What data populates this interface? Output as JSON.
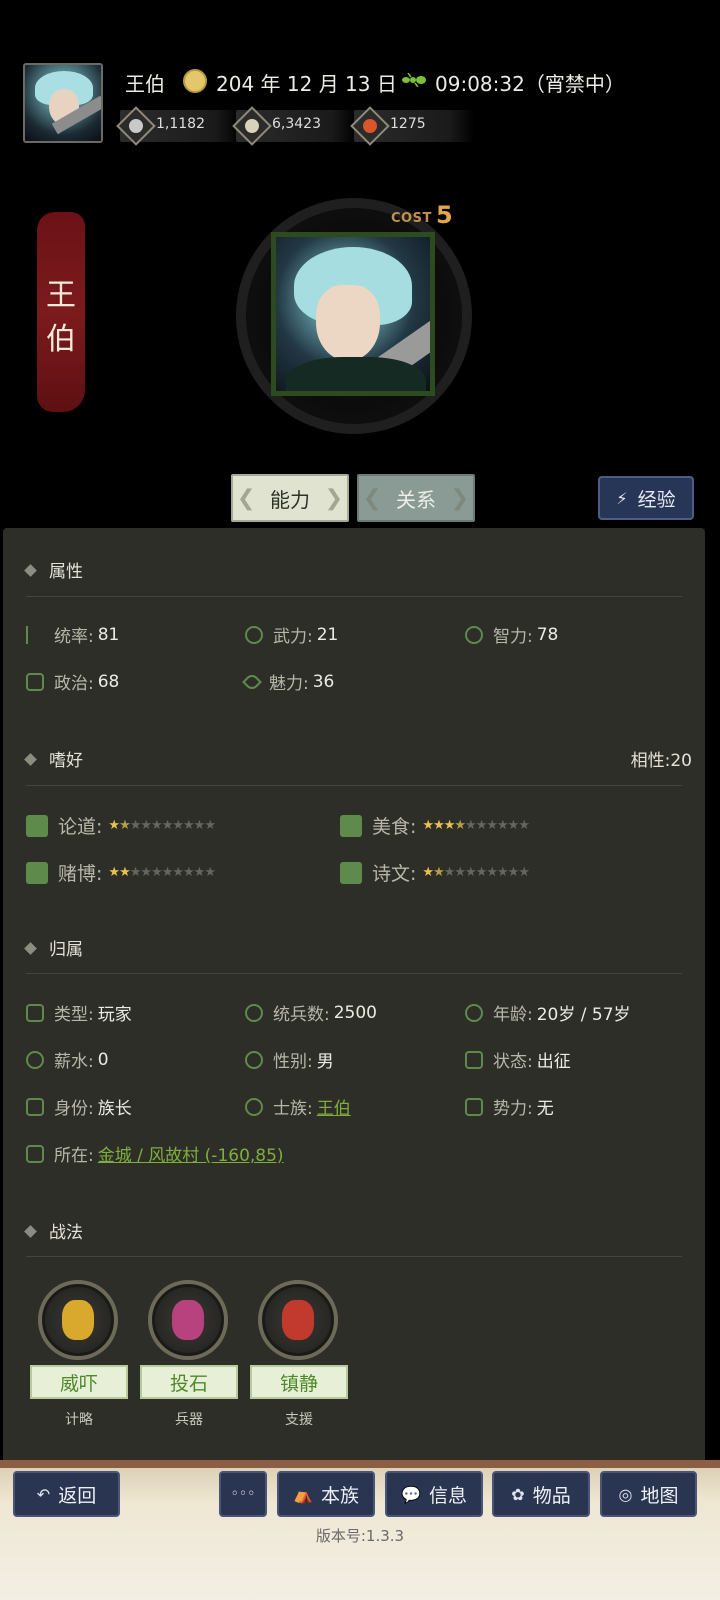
{
  "header": {
    "name": "王伯",
    "date": "204 年 12 月 13 日",
    "time": "09:08:32（宵禁中）",
    "resources": [
      {
        "icon": "coin-icon",
        "value": "1,1182"
      },
      {
        "icon": "grain-icon",
        "value": "6,3423"
      },
      {
        "icon": "gem-icon",
        "value": "1275"
      }
    ]
  },
  "profile": {
    "banner_chars": [
      "王",
      "伯"
    ],
    "cost_label": "COST",
    "cost_value": "5"
  },
  "tabs": {
    "ability": "能力",
    "relation": "关系",
    "experience": "经验"
  },
  "attributes": {
    "title": "属性",
    "items": [
      {
        "label": "统率:",
        "value": "81"
      },
      {
        "label": "武力:",
        "value": "21"
      },
      {
        "label": "智力:",
        "value": "78"
      },
      {
        "label": "政治:",
        "value": "68"
      },
      {
        "label": "魅力:",
        "value": "36"
      }
    ]
  },
  "hobbies": {
    "title": "嗜好",
    "affinity": "相性:20",
    "items": [
      {
        "label": "论道:",
        "rating": 1.5,
        "max": 10
      },
      {
        "label": "美食:",
        "rating": 3.5,
        "max": 10
      },
      {
        "label": "赌博:",
        "rating": 2,
        "max": 10
      },
      {
        "label": "诗文:",
        "rating": 1.5,
        "max": 10
      }
    ]
  },
  "belonging": {
    "title": "归属",
    "type_label": "类型:",
    "type_value": "玩家",
    "troops_label": "统兵数:",
    "troops_value": "2500",
    "age_label": "年龄:",
    "age_value": "20岁 / 57岁",
    "salary_label": "薪水:",
    "salary_value": "0",
    "gender_label": "性别:",
    "gender_value": "男",
    "status_label": "状态:",
    "status_value": "出征",
    "identity_label": "身份:",
    "identity_value": "族长",
    "clan_label": "士族:",
    "clan_value": "王伯",
    "faction_label": "势力:",
    "faction_value": "无",
    "location_label": "所在:",
    "location_value": "金城 / 风故村 (-160,85)"
  },
  "tactics": {
    "title": "战法",
    "skills": [
      {
        "name": "威吓",
        "type": "计略",
        "color": "#d9a92e"
      },
      {
        "name": "投石",
        "type": "兵器",
        "color": "#b8427e"
      },
      {
        "name": "镇静",
        "type": "支援",
        "color": "#c23a2e"
      }
    ]
  },
  "nav": {
    "back": "返回",
    "more": "◦◦◦",
    "clan": "本族",
    "info": "信息",
    "items": "物品",
    "map": "地图"
  },
  "version": "版本号:1.3.3"
}
